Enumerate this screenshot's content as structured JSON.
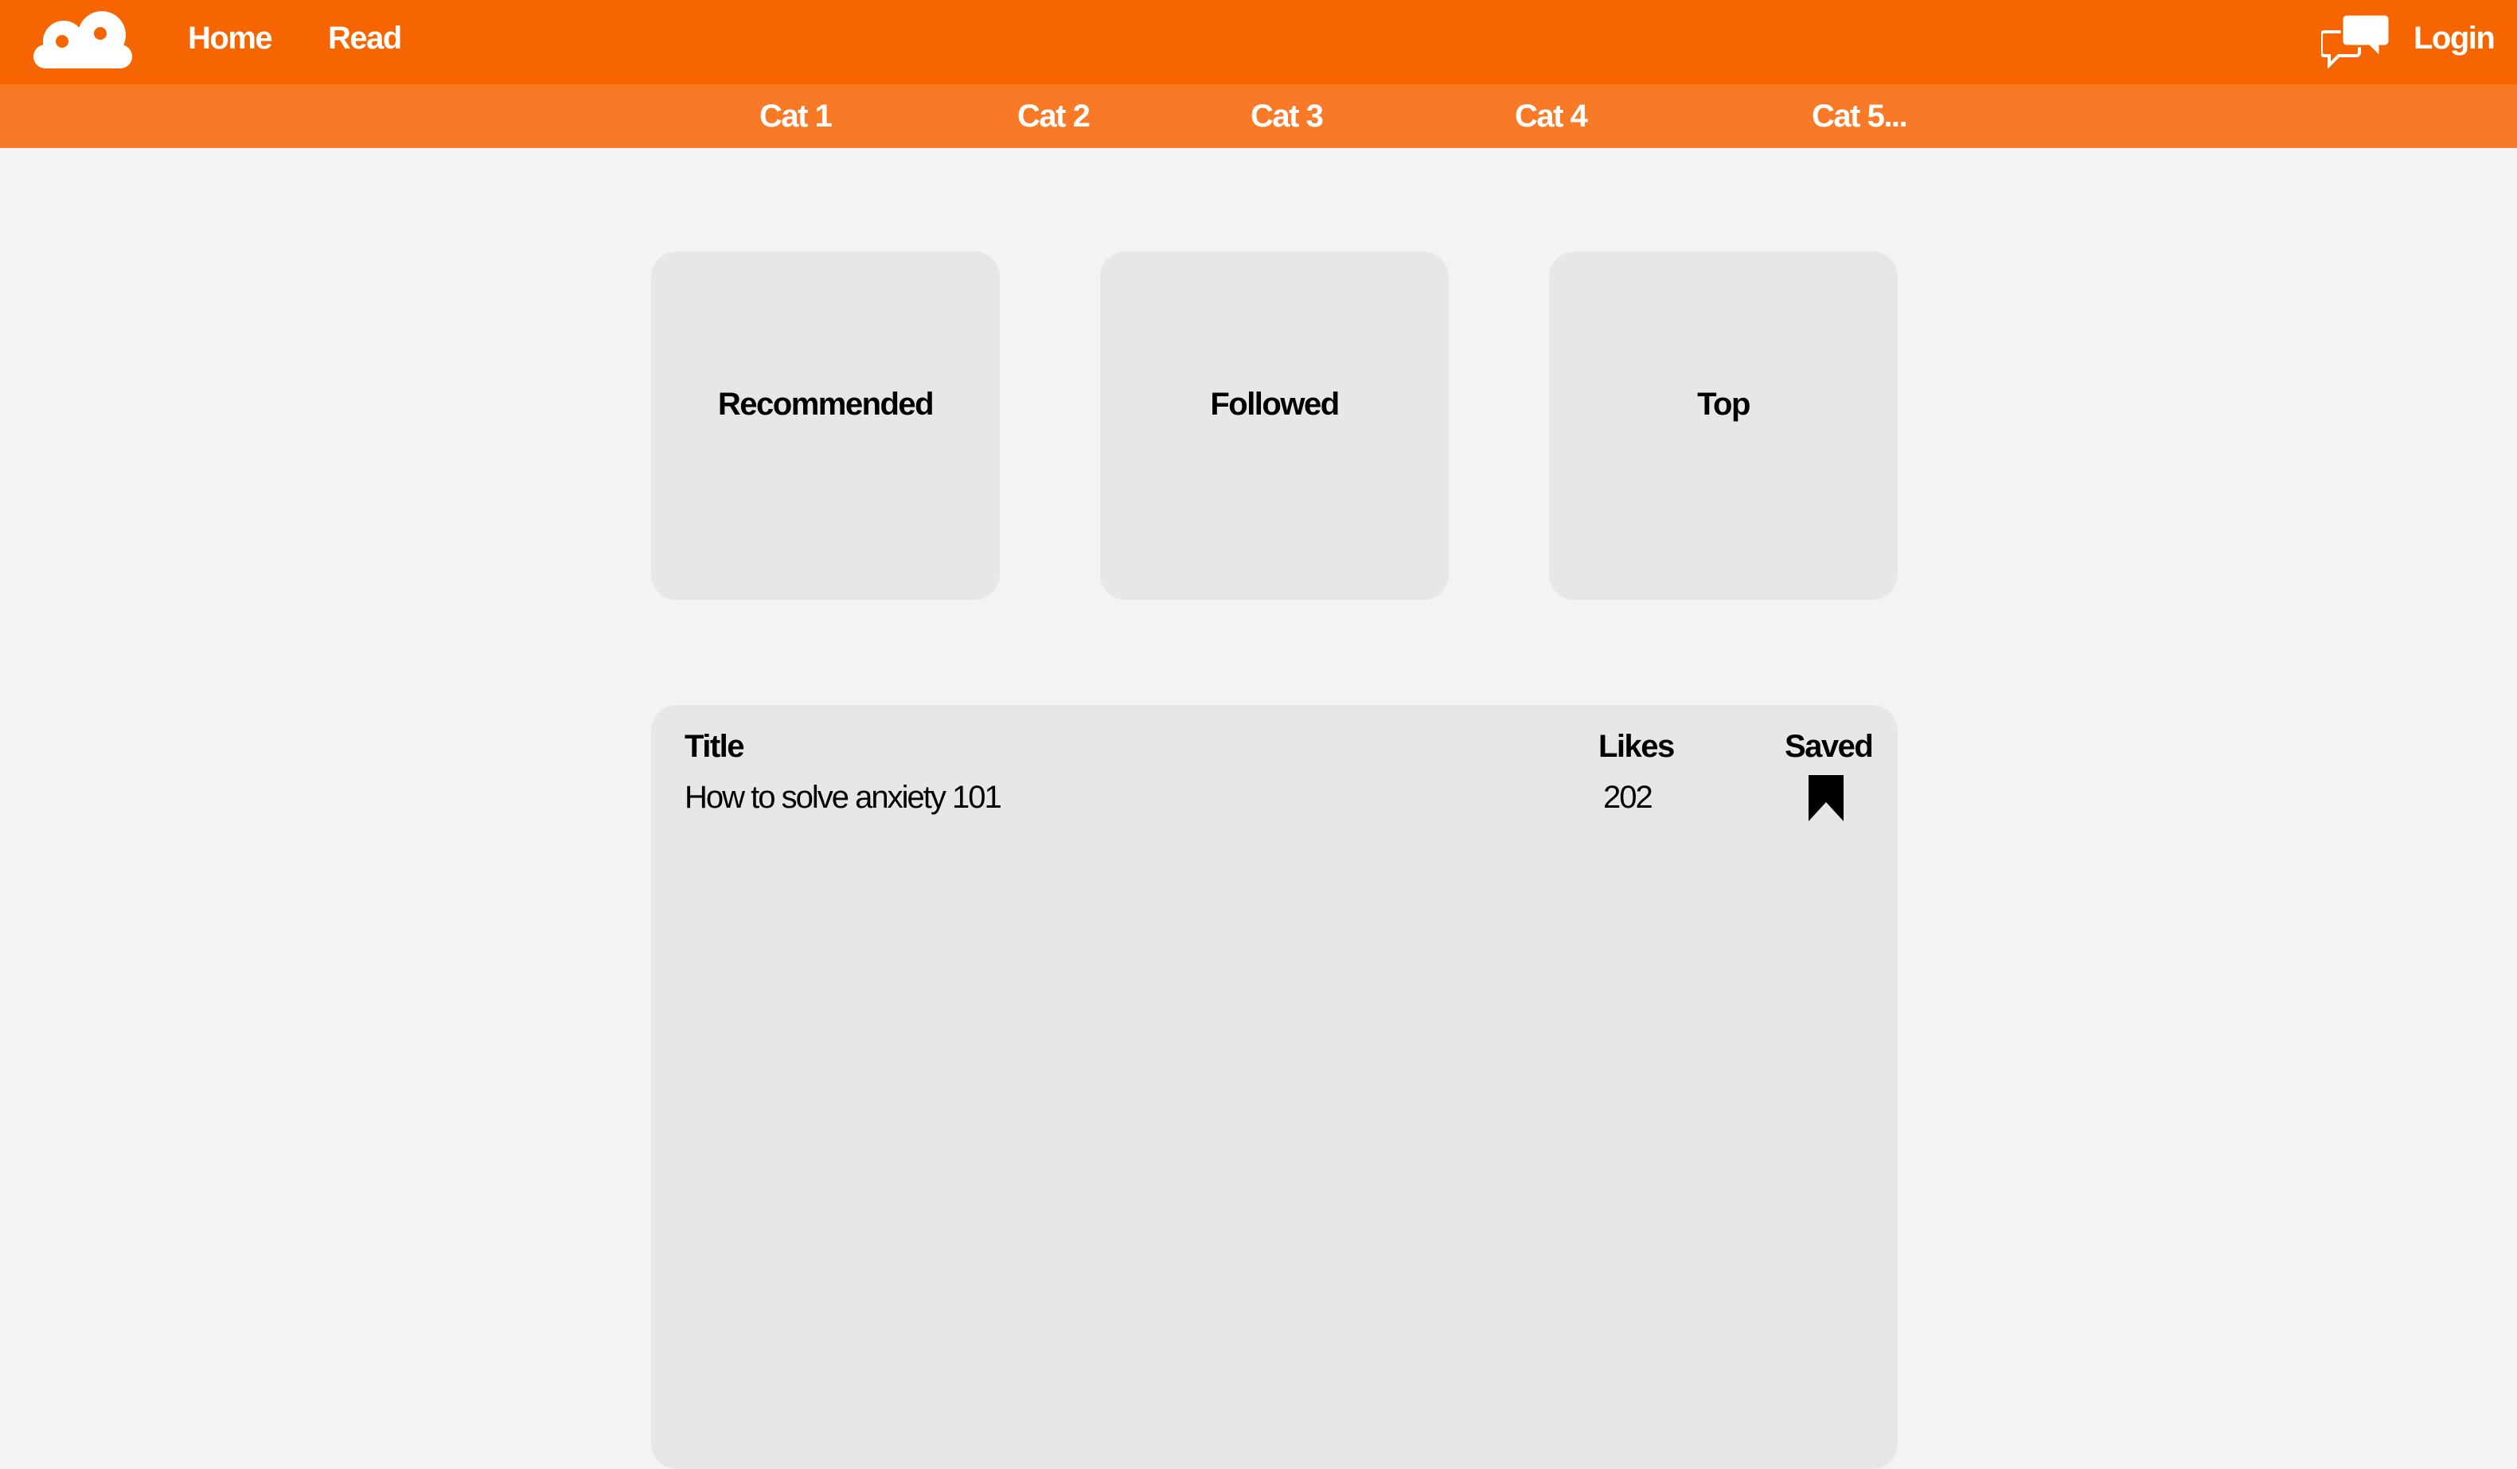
{
  "colors": {
    "primary_orange": "#f76501",
    "secondary_orange": "#f87a27",
    "background": "#f3f3f3",
    "card": "#e7e7e7"
  },
  "header": {
    "logo_icon": "cloud-logo-icon",
    "nav": [
      "Home",
      "Read"
    ],
    "chat_icon": "chat-bubbles-icon",
    "login_label": "Login"
  },
  "categories": [
    "Cat 1",
    "Cat 2",
    "Cat 3",
    "Cat 4",
    "Cat 5..."
  ],
  "cards": [
    "Recommended",
    "Followed",
    "Top"
  ],
  "table": {
    "columns": [
      "Title",
      "Likes",
      "Saved"
    ],
    "rows": [
      {
        "title": "How to solve anxiety 101",
        "likes": "202",
        "saved_icon": "bookmark-filled-icon"
      }
    ]
  }
}
